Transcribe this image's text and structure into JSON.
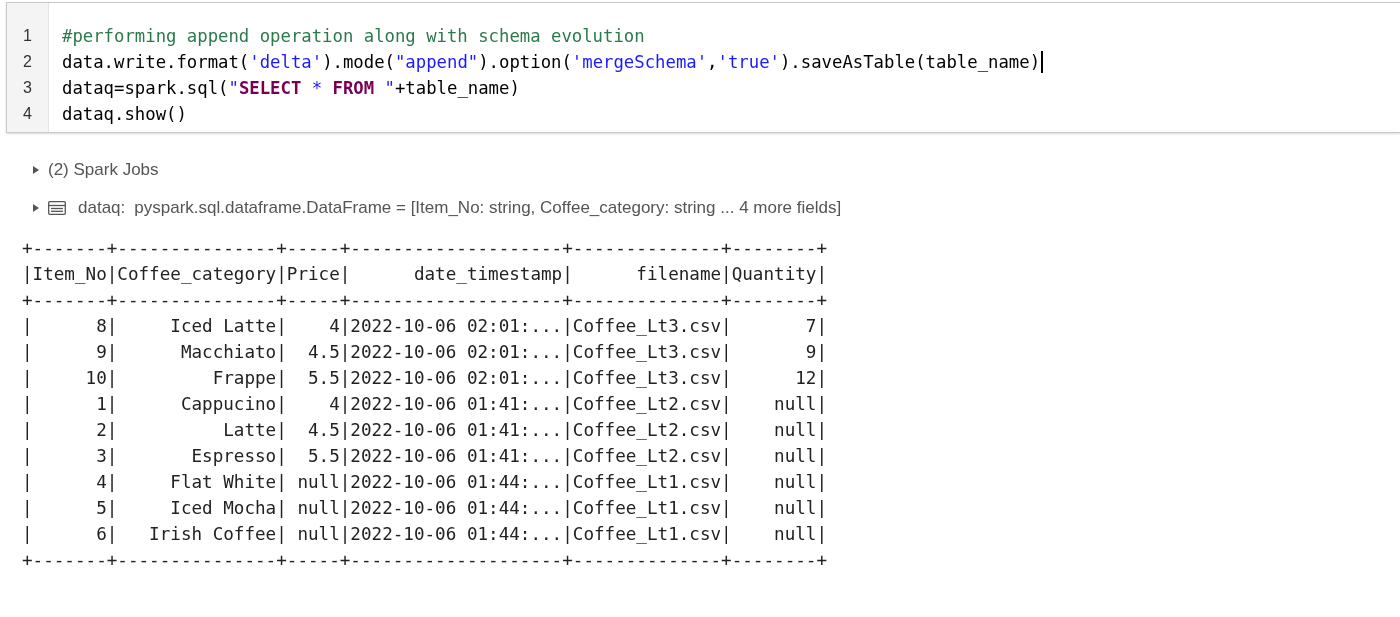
{
  "code_cell": {
    "lines": [
      {
        "number": "1",
        "tokens": [
          {
            "kind": "comment",
            "text": "#performing append operation along with schema evolution"
          }
        ]
      },
      {
        "number": "2",
        "tokens": [
          {
            "kind": "plain",
            "text": "data.write.format("
          },
          {
            "kind": "string",
            "text": "'delta'"
          },
          {
            "kind": "plain",
            "text": ").mode("
          },
          {
            "kind": "string",
            "text": "\"append\""
          },
          {
            "kind": "plain",
            "text": ").option("
          },
          {
            "kind": "string",
            "text": "'mergeSchema'"
          },
          {
            "kind": "plain",
            "text": ","
          },
          {
            "kind": "string",
            "text": "'true'"
          },
          {
            "kind": "plain",
            "text": ").saveAsTable(table_name)"
          }
        ],
        "cursor": true
      },
      {
        "number": "3",
        "tokens": [
          {
            "kind": "plain",
            "text": "dataq=spark.sql("
          },
          {
            "kind": "string",
            "text": "\""
          },
          {
            "kind": "keyword",
            "text": "SELECT"
          },
          {
            "kind": "string",
            "text": " * "
          },
          {
            "kind": "keyword",
            "text": "FROM"
          },
          {
            "kind": "string",
            "text": " \""
          },
          {
            "kind": "plain",
            "text": "+table_name)"
          }
        ]
      },
      {
        "number": "4",
        "tokens": [
          {
            "kind": "plain",
            "text": "dataq.show()"
          }
        ]
      }
    ]
  },
  "spark_jobs": {
    "label": "(2) Spark Jobs",
    "expanded": false
  },
  "dataframe": {
    "name": "dataq:",
    "schema": "pyspark.sql.dataframe.DataFrame = [Item_No: string, Coffee_category: string ... 4 more fields]",
    "expanded": false
  },
  "table_output": [
    "+-------+---------------+-----+--------------------+--------------+--------+",
    "|Item_No|Coffee_category|Price|      date_timestamp|      filename|Quantity|",
    "+-------+---------------+-----+--------------------+--------------+--------+",
    "|      8|     Iced Latte|    4|2022-10-06 02:01:...|Coffee_Lt3.csv|       7|",
    "|      9|      Macchiato|  4.5|2022-10-06 02:01:...|Coffee_Lt3.csv|       9|",
    "|     10|         Frappe|  5.5|2022-10-06 02:01:...|Coffee_Lt3.csv|      12|",
    "|      1|      Cappucino|    4|2022-10-06 01:41:...|Coffee_Lt2.csv|    null|",
    "|      2|          Latte|  4.5|2022-10-06 01:41:...|Coffee_Lt2.csv|    null|",
    "|      3|       Espresso|  5.5|2022-10-06 01:41:...|Coffee_Lt2.csv|    null|",
    "|      4|     Flat White| null|2022-10-06 01:44:...|Coffee_Lt1.csv|    null|",
    "|      5|     Iced Mocha| null|2022-10-06 01:44:...|Coffee_Lt1.csv|    null|",
    "|      6|   Irish Coffee| null|2022-10-06 01:44:...|Coffee_Lt1.csv|    null|",
    "+-------+---------------+-----+--------------------+--------------+--------+"
  ]
}
